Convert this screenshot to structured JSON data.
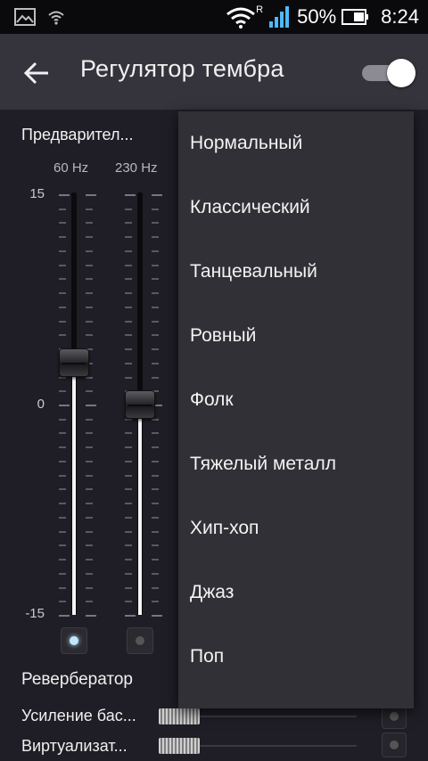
{
  "status_bar": {
    "battery_percent": "50%",
    "time": "8:24",
    "icons": [
      "gallery-icon",
      "wifi-small-icon",
      "wifi-icon",
      "signal-icon",
      "battery-icon"
    ],
    "roaming_indicator": "R"
  },
  "action_bar": {
    "title": "Регулятор тембра",
    "toggle_on": true
  },
  "equalizer": {
    "preset_label": "Предварител...",
    "bands": [
      {
        "freq": "60 Hz",
        "level": 3,
        "active": true
      },
      {
        "freq": "230 Hz",
        "level": 0,
        "active": false
      }
    ],
    "scale": {
      "max": "15",
      "mid": "0",
      "min": "-15"
    }
  },
  "effects": {
    "reverb_label": "Ревербератор",
    "bass_boost_label": "Усиление бас...",
    "virtualizer_label": "Виртуализат..."
  },
  "preset_menu": {
    "items": [
      "Нормальный",
      "Классический",
      "Танцевальный",
      "Ровный",
      "Фолк",
      "Тяжелый металл",
      "Хип-хоп",
      "Джаз",
      "Поп"
    ]
  },
  "colors": {
    "accent_active": "#bfe8ff",
    "background": "#1f1e26",
    "action_bar": "#35343d",
    "menu": "#303036"
  }
}
